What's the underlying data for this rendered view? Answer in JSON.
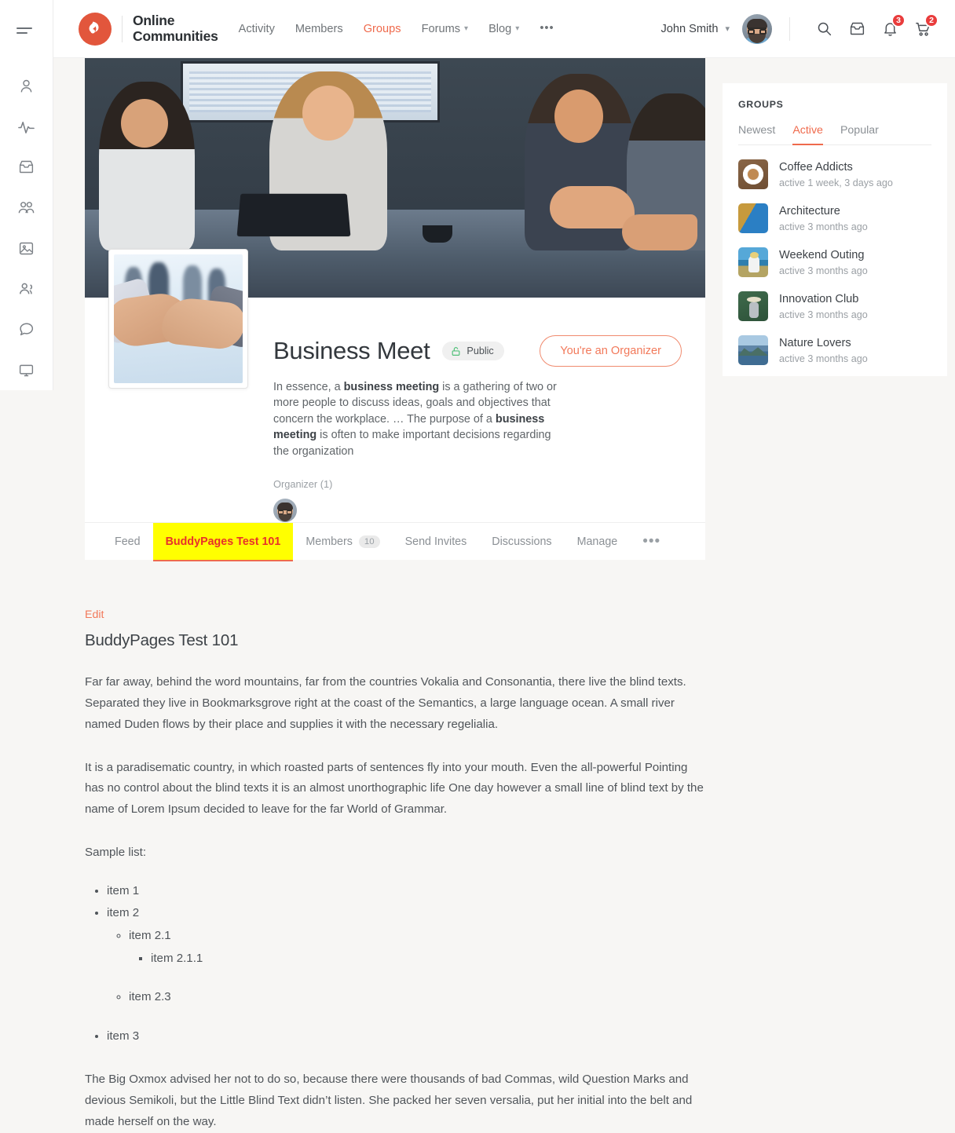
{
  "sidebar_rail": {
    "toggle": "menu-toggle",
    "items": [
      {
        "icon": "profile-icon"
      },
      {
        "icon": "activity-pulse-icon"
      },
      {
        "icon": "inbox-icon"
      },
      {
        "icon": "groups-icon"
      },
      {
        "icon": "photos-icon"
      },
      {
        "icon": "friends-icon"
      },
      {
        "icon": "messages-icon"
      },
      {
        "icon": "monitor-icon"
      }
    ]
  },
  "header": {
    "brand_line1": "Online",
    "brand_line2": "Communities",
    "nav": [
      {
        "label": "Activity",
        "active": false,
        "caret": false
      },
      {
        "label": "Members",
        "active": false,
        "caret": false
      },
      {
        "label": "Groups",
        "active": true,
        "caret": false
      },
      {
        "label": "Forums",
        "active": false,
        "caret": true
      },
      {
        "label": "Blog",
        "active": false,
        "caret": true
      }
    ],
    "nav_more": "•••",
    "user_name": "John Smith",
    "user_caret": "⌄",
    "search_icon": "search-icon",
    "inbox_icon": "inbox-icon",
    "notifications_icon": "bell-icon",
    "notifications_count": "3",
    "cart_icon": "cart-icon",
    "cart_count": "2"
  },
  "group": {
    "title": "Business Meet",
    "privacy_label": "Public",
    "organizer_button": "You're an Organizer",
    "description_parts": [
      {
        "text": "In essence, a ",
        "bold": false
      },
      {
        "text": "business meeting",
        "bold": true
      },
      {
        "text": " is a gathering of two or more people to discuss ideas, goals and objectives that concern the workplace. … The purpose of a ",
        "bold": false
      },
      {
        "text": "business meeting",
        "bold": true
      },
      {
        "text": " is often to make important decisions regarding the organization",
        "bold": false
      }
    ],
    "organizer_label": "Organizer (1)",
    "tabs": [
      {
        "label": "Feed",
        "highlighted": false,
        "count": null
      },
      {
        "label": "BuddyPages Test 101",
        "highlighted": true,
        "count": null
      },
      {
        "label": "Members",
        "highlighted": false,
        "count": "10"
      },
      {
        "label": "Send Invites",
        "highlighted": false,
        "count": null
      },
      {
        "label": "Discussions",
        "highlighted": false,
        "count": null
      },
      {
        "label": "Manage",
        "highlighted": false,
        "count": null
      }
    ],
    "tabs_more": "•••"
  },
  "article": {
    "edit_label": "Edit",
    "title": "BuddyPages Test 101",
    "paragraph_1": "Far far away, behind the word mountains, far from the countries Vokalia and Consonantia, there live the blind texts. Separated they live in Bookmarksgrove right at the coast of the Semantics, a large language ocean. A small river named Duden flows by their place and supplies it with the necessary regelialia.",
    "paragraph_2": "It is a paradisematic country, in which roasted parts of sentences fly into your mouth. Even the all-powerful Pointing has no control about the blind texts it is an almost unorthographic life One day however a small line of blind text by the name of Lorem Ipsum decided to leave for the far World of Grammar.",
    "list_intro": "Sample list:",
    "list": {
      "item1": "item 1",
      "item2": "item 2",
      "item21": "item 2.1",
      "item211": "item 2.1.1",
      "item23": "item 2.3",
      "item3": "item 3"
    },
    "paragraph_3": "The Big Oxmox advised her not to do so, because there were thousands of bad Commas, wild Question Marks and devious Semikoli, but the Little Blind Text didn’t listen. She packed her seven versalia, put her initial into the belt and made herself on the way."
  },
  "groups_widget": {
    "title": "Groups",
    "tabs": [
      {
        "label": "Newest",
        "active": false
      },
      {
        "label": "Active",
        "active": true
      },
      {
        "label": "Popular",
        "active": false
      }
    ],
    "items": [
      {
        "name": "Coffee Addicts",
        "active": "active 1 week, 3 days ago",
        "thumb": "th-coffee"
      },
      {
        "name": "Architecture",
        "active": "active 3 months ago",
        "thumb": "th-arch"
      },
      {
        "name": "Weekend Outing",
        "active": "active 3 months ago",
        "thumb": "th-week"
      },
      {
        "name": "Innovation Club",
        "active": "active 3 months ago",
        "thumb": "th-inno"
      },
      {
        "name": "Nature Lovers",
        "active": "active 3 months ago",
        "thumb": "th-nature"
      }
    ]
  },
  "colors": {
    "accent": "#ef6a4c",
    "brand": "#e2563c",
    "highlight_bg": "#ffff00",
    "highlight_text": "#e8312a",
    "badge_red": "#e93c3c",
    "public_green": "#52c07a",
    "page_bg": "#f7f6f4"
  }
}
